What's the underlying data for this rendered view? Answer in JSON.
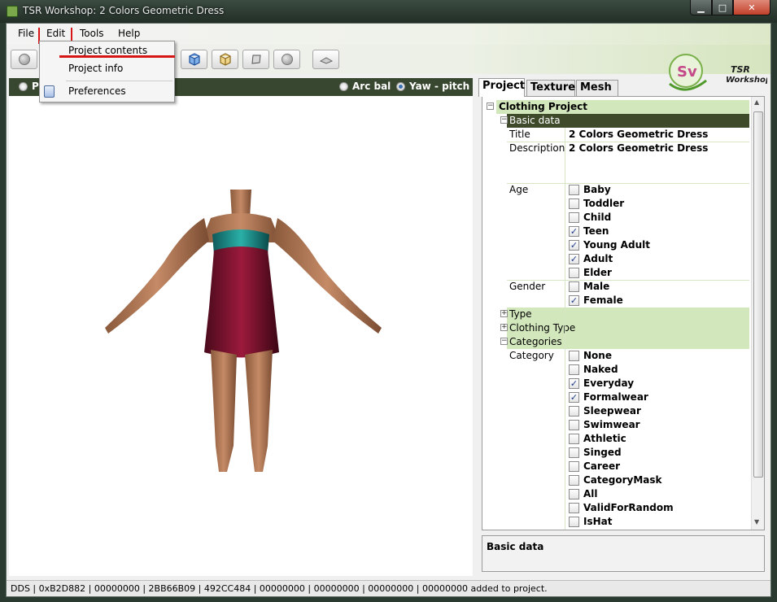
{
  "window": {
    "title": "TSR Workshop: 2 Colors Geometric Dress",
    "controls": {
      "minimize": "▁",
      "maximize": "□",
      "close": "✕"
    }
  },
  "menubar": {
    "items": [
      "File",
      "Edit",
      "Tools",
      "Help"
    ]
  },
  "edit_menu": {
    "items": [
      "Project contents",
      "Project info",
      "Preferences"
    ]
  },
  "logo": {
    "badge_text": "Sv",
    "brand_line1": "TSR",
    "brand_line2": "Workshop"
  },
  "viewport": {
    "left_radio_label": "P",
    "camera_modes": [
      {
        "label": "Arc bal",
        "selected": false
      },
      {
        "label": "Yaw - pitch",
        "selected": true
      }
    ]
  },
  "tabs": [
    "Project",
    "Texture",
    "Mesh"
  ],
  "tree": {
    "root": "Clothing Project",
    "basic_data": "Basic data",
    "title_label": "Title",
    "title_value": "2 Colors Geometric Dress",
    "description_label": "Description",
    "description_value": "2 Colors Geometric Dress",
    "age_label": "Age",
    "ages": [
      {
        "label": "Baby",
        "checked": false
      },
      {
        "label": "Toddler",
        "checked": false
      },
      {
        "label": "Child",
        "checked": false
      },
      {
        "label": "Teen",
        "checked": true
      },
      {
        "label": "Young Adult",
        "checked": true
      },
      {
        "label": "Adult",
        "checked": true
      },
      {
        "label": "Elder",
        "checked": false
      }
    ],
    "gender_label": "Gender",
    "genders": [
      {
        "label": "Male",
        "checked": false
      },
      {
        "label": "Female",
        "checked": true
      }
    ],
    "type": "Type",
    "clothing_type": "Clothing Type",
    "categories": "Categories",
    "category_label": "Category",
    "category_items": [
      {
        "label": "None",
        "checked": false
      },
      {
        "label": "Naked",
        "checked": false
      },
      {
        "label": "Everyday",
        "checked": true
      },
      {
        "label": "Formalwear",
        "checked": true
      },
      {
        "label": "Sleepwear",
        "checked": false
      },
      {
        "label": "Swimwear",
        "checked": false
      },
      {
        "label": "Athletic",
        "checked": false
      },
      {
        "label": "Singed",
        "checked": false
      },
      {
        "label": "Career",
        "checked": false
      },
      {
        "label": "CategoryMask",
        "checked": false
      },
      {
        "label": "All",
        "checked": false
      },
      {
        "label": "ValidForRandom",
        "checked": false
      },
      {
        "label": "IsHat",
        "checked": false
      }
    ]
  },
  "info_panel": {
    "label": "Basic data"
  },
  "status": {
    "text": "DDS | 0xB2D882 | 00000000 | 2BB66B09 | 492CC484 | 00000000 | 00000000 | 00000000 | 00000000 added to project."
  }
}
